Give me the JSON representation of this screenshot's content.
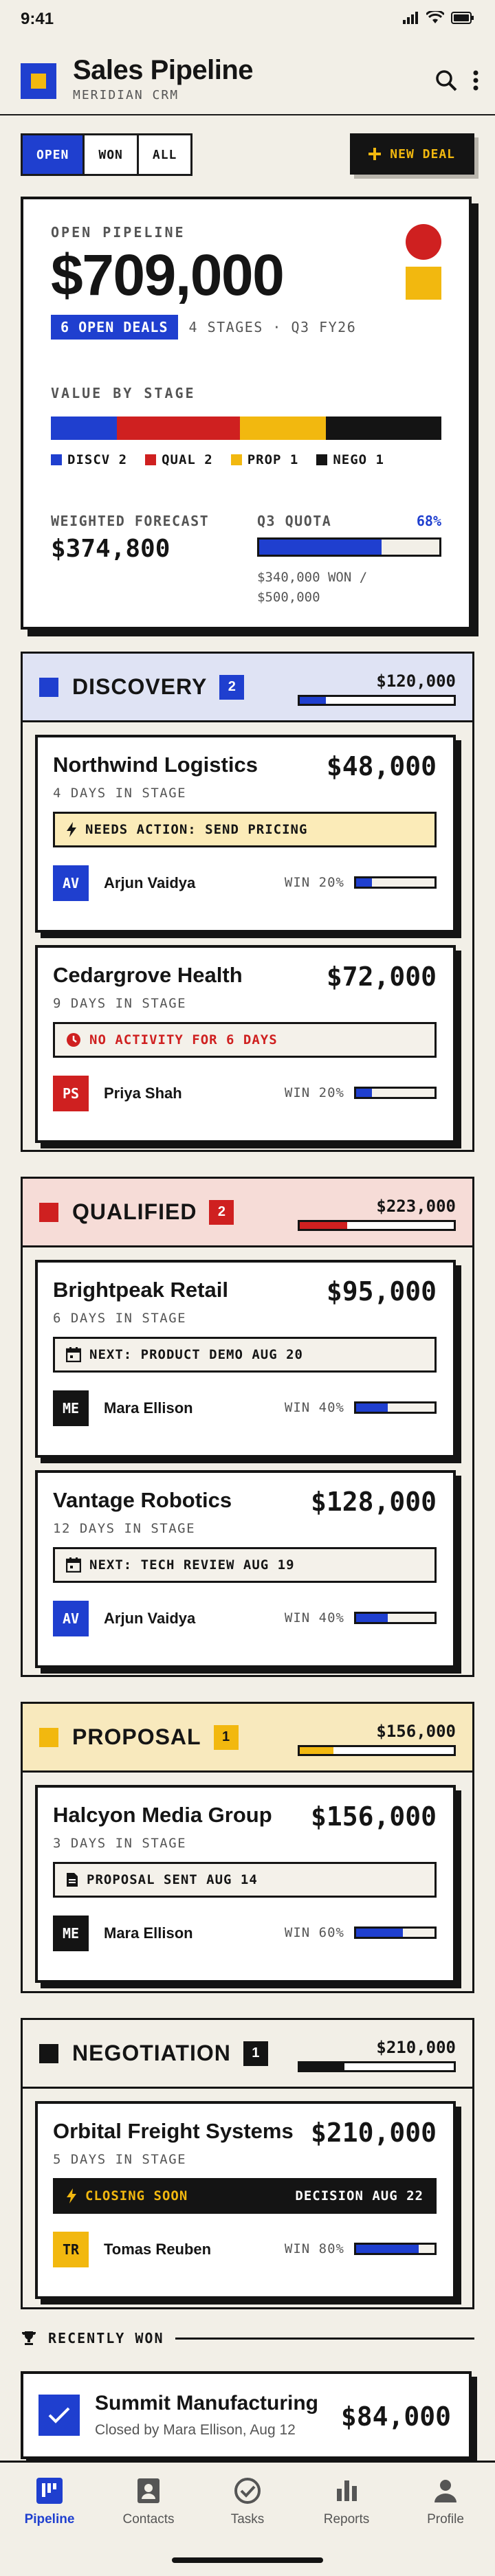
{
  "status_bar": {
    "time": "9:41"
  },
  "header": {
    "title": "Sales Pipeline",
    "subtitle": "MERIDIAN CRM"
  },
  "filters": {
    "tabs": [
      "OPEN",
      "WON",
      "ALL"
    ],
    "active": "OPEN"
  },
  "new_deal_label": "NEW DEAL",
  "summary": {
    "label": "OPEN PIPELINE",
    "total": "$709,000",
    "open_badge": "6 OPEN DEALS",
    "meta": "4 STAGES · Q3 FY26",
    "value_by_stage_label": "VALUE BY STAGE",
    "stage_shares": [
      {
        "name": "DISCV",
        "value": 120000,
        "color": "#1f3fcf"
      },
      {
        "name": "QUAL",
        "value": 223000,
        "color": "#cf2020"
      },
      {
        "name": "PROP",
        "value": 156000,
        "color": "#f2b80f"
      },
      {
        "name": "NEGO",
        "value": 210000,
        "color": "#141414"
      }
    ],
    "legend": [
      "DISCV 2",
      "QUAL 2",
      "PROP 1",
      "NEGO 1"
    ],
    "weighted_label": "WEIGHTED FORECAST",
    "weighted_value": "$374,800",
    "quota_label": "Q3 QUOTA",
    "quota_pct": "68%",
    "quota_fraction": 0.68,
    "quota_note_1": "$340,000 WON /",
    "quota_note_2": "$500,000"
  },
  "stages": {
    "discovery": {
      "name": "DISCOVERY",
      "count": "2",
      "amount": "$120,000",
      "fill": 0.17,
      "color": "#1f3fcf",
      "bg": "#dfe3f4"
    },
    "qualified": {
      "name": "QUALIFIED",
      "count": "2",
      "amount": "$223,000",
      "fill": 0.31,
      "color": "#cf2020",
      "bg": "#f6dcd7"
    },
    "proposal": {
      "name": "PROPOSAL",
      "count": "1",
      "amount": "$156,000",
      "fill": 0.22,
      "color": "#f2b80f",
      "bg": "#f8e9bd"
    },
    "negotiation": {
      "name": "NEGOTIATION",
      "count": "1",
      "amount": "$210,000",
      "fill": 0.29,
      "color": "#141414",
      "bg": "#f2efe7"
    }
  },
  "deals": [
    {
      "name": "Northwind Logistics",
      "amount": "$48,000",
      "days": "4 DAYS IN STAGE",
      "note": "NEEDS ACTION: SEND PRICING",
      "owner": "Arjun Vaidya",
      "initials": "AV",
      "avatar_color": "#1f3fcf",
      "win": "WIN 20%",
      "win_fraction": 0.2
    },
    {
      "name": "Cedargrove Health",
      "amount": "$72,000",
      "days": "9 DAYS IN STAGE",
      "note": "NO ACTIVITY FOR 6 DAYS",
      "owner": "Priya Shah",
      "initials": "PS",
      "avatar_color": "#cf2020",
      "win": "WIN 20%",
      "win_fraction": 0.2
    },
    {
      "name": "Brightpeak Retail",
      "amount": "$95,000",
      "days": "6 DAYS IN STAGE",
      "note": "NEXT: PRODUCT DEMO AUG 20",
      "owner": "Mara Ellison",
      "initials": "ME",
      "avatar_color": "#141414",
      "win": "WIN 40%",
      "win_fraction": 0.4
    },
    {
      "name": "Vantage Robotics",
      "amount": "$128,000",
      "days": "12 DAYS IN STAGE",
      "note": "NEXT: TECH REVIEW AUG 19",
      "owner": "Arjun Vaidya",
      "initials": "AV",
      "avatar_color": "#1f3fcf",
      "win": "WIN 40%",
      "win_fraction": 0.4
    },
    {
      "name": "Halcyon Media Group",
      "amount": "$156,000",
      "days": "3 DAYS IN STAGE",
      "note": "PROPOSAL SENT AUG 14",
      "owner": "Mara Ellison",
      "initials": "ME",
      "avatar_color": "#141414",
      "win": "WIN 60%",
      "win_fraction": 0.6
    },
    {
      "name": "Orbital Freight Systems",
      "amount": "$210,000",
      "days": "5 DAYS IN STAGE",
      "note": "CLOSING SOON",
      "note_right": "DECISION AUG 22",
      "owner": "Tomas Reuben",
      "initials": "TR",
      "avatar_color": "#f2b80f",
      "win": "WIN 80%",
      "win_fraction": 0.8
    }
  ],
  "recently_won": {
    "label": "RECENTLY WON",
    "name": "Summit Manufacturing",
    "sub": "Closed by Mara Ellison, Aug 12",
    "amount": "$84,000"
  },
  "nav": [
    "Pipeline",
    "Contacts",
    "Tasks",
    "Reports",
    "Profile"
  ]
}
